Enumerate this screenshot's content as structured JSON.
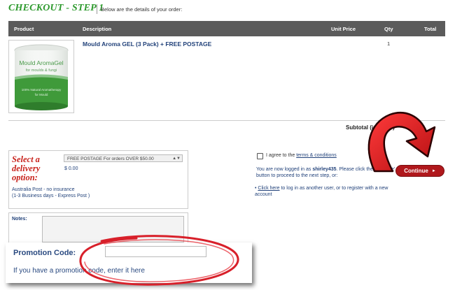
{
  "header": {
    "step_title": "CHECKOUT - STEP 1",
    "subtitle": "Below are the details of your order:"
  },
  "table": {
    "columns": [
      "Product",
      "Description",
      "Unit Price",
      "Qty",
      "Total"
    ],
    "rows": [
      {
        "description": "Mould Aroma GEL (3 Pack) + FREE POSTAGE",
        "qty": "1",
        "image_text": [
          "Mould AromaGel",
          "for moulds & fungi",
          "100% Natural Aromatherapy",
          "for Mould"
        ]
      }
    ],
    "subtotal_label": "Subtotal (inc GST)"
  },
  "delivery": {
    "title": "Select a delivery option:",
    "selected_option": "FREE POSTAGE For orders OVER $50.00",
    "price": "$ 0.00",
    "note_line1": "Australia Post - no insurance",
    "note_line2": "(1-3 Business days - Express Post )"
  },
  "notes": {
    "label": "Notes:"
  },
  "promo": {
    "label": "Promotion Code:",
    "value": "",
    "hint": "If you have a promotion code, enter it here"
  },
  "checkout": {
    "agree_prefix": "I agree to the ",
    "agree_link": "terms & conditions",
    "logged_prefix": "You are now logged in as ",
    "username": "shirley435",
    "logged_suffix": ". Please click the 'continue' button to proceed to the next step, or:",
    "click_link": "Click here",
    "click_suffix": " to log in as another user, or to register with a new account",
    "continue_label": "Continue"
  },
  "colors": {
    "accent_green": "#2e9a2e",
    "accent_red": "#c8221b",
    "link_blue": "#22427a",
    "header_bg": "#5b5b5b"
  }
}
